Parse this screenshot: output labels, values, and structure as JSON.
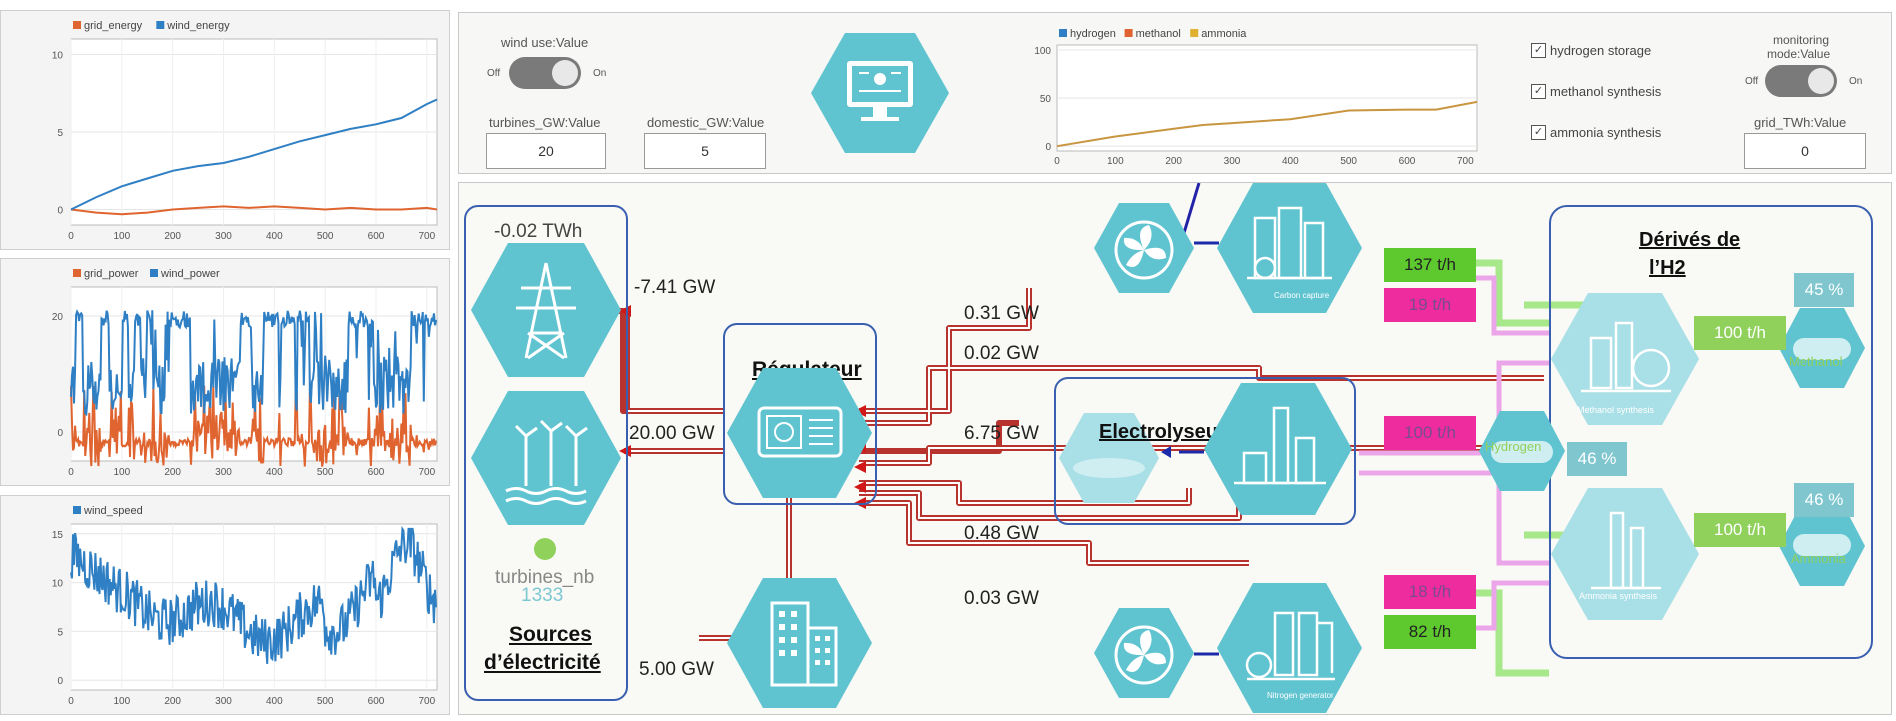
{
  "left_charts": [
    {
      "legend": [
        {
          "name": "grid_energy",
          "color": "#e0642f"
        },
        {
          "name": "wind_energy",
          "color": "#2f7fc4"
        }
      ],
      "ylim": [
        -1,
        11
      ],
      "yticks": [
        "10",
        "5",
        "0"
      ],
      "xticks": [
        "0",
        "100",
        "200",
        "300",
        "400",
        "500",
        "600",
        "700"
      ]
    },
    {
      "legend": [
        {
          "name": "grid_power",
          "color": "#e0642f"
        },
        {
          "name": "wind_power",
          "color": "#2f7fc4"
        }
      ],
      "ylim": [
        -5,
        25
      ],
      "yticks": [
        "20",
        "0"
      ],
      "xticks": [
        "0",
        "100",
        "200",
        "300",
        "400",
        "500",
        "600",
        "700"
      ]
    },
    {
      "legend": [
        {
          "name": "wind_speed",
          "color": "#2f7fc4"
        }
      ],
      "ylim": [
        -1,
        16
      ],
      "yticks": [
        "15",
        "10",
        "5",
        "0"
      ],
      "xticks": [
        "0",
        "100",
        "200",
        "300",
        "400",
        "500",
        "600",
        "700"
      ]
    }
  ],
  "controls": {
    "wind_use_label": "wind use:Value",
    "off": "Off",
    "on": "On",
    "turbines_label": "turbines_GW:Value",
    "turbines_value": "20",
    "domestic_label": "domestic_GW:Value",
    "domestic_value": "5",
    "monitoring_label_1": "monitoring",
    "monitoring_label_2": "mode:Value",
    "grid_twh_label": "grid_TWh:Value",
    "grid_twh_value": "0",
    "checks": [
      "hydrogen storage",
      "methanol synthesis",
      "ammonia synthesis"
    ]
  },
  "chart_data": [
    {
      "type": "line",
      "x": [
        0,
        50,
        100,
        150,
        200,
        250,
        300,
        350,
        400,
        450,
        500,
        550,
        600,
        650,
        700,
        720
      ],
      "series": [
        {
          "name": "wind_energy",
          "color": "#2f7fc4",
          "values": [
            0,
            0.8,
            1.5,
            2.0,
            2.5,
            2.8,
            3.0,
            3.4,
            3.9,
            4.4,
            4.8,
            5.2,
            5.5,
            5.9,
            6.8,
            7.1
          ]
        },
        {
          "name": "grid_energy",
          "color": "#e0642f",
          "values": [
            0,
            -0.2,
            -0.3,
            -0.2,
            0,
            0.1,
            0.2,
            0.1,
            0.2,
            0.1,
            0,
            0.1,
            0,
            0,
            0.1,
            0
          ]
        }
      ],
      "xlim": [
        0,
        720
      ],
      "ylim": [
        -1,
        11
      ]
    },
    {
      "type": "line",
      "x": [
        0,
        720
      ],
      "series": [
        {
          "name": "grid_power",
          "color": "#e0642f",
          "values": []
        },
        {
          "name": "wind_power",
          "color": "#2f7fc4",
          "values": []
        }
      ],
      "xlim": [
        0,
        720
      ],
      "ylim": [
        -5,
        25
      ]
    },
    {
      "type": "line",
      "x": [
        0,
        720
      ],
      "series": [
        {
          "name": "wind_speed",
          "color": "#2f7fc4",
          "values": []
        }
      ],
      "xlim": [
        0,
        720
      ],
      "ylim": [
        -1,
        16
      ]
    },
    {
      "type": "line",
      "legend": [
        {
          "name": "hydrogen",
          "color": "#2f7fc4"
        },
        {
          "name": "methanol",
          "color": "#e0642f"
        },
        {
          "name": "ammonia",
          "color": "#e0b030"
        }
      ],
      "x": [
        0,
        100,
        200,
        250,
        300,
        400,
        500,
        600,
        650,
        720
      ],
      "series": [
        {
          "name": "ammonia",
          "color": "#c89540",
          "values": [
            0,
            10,
            18,
            22,
            24,
            28,
            37,
            38,
            38,
            46
          ]
        }
      ],
      "yticks": [
        "100",
        "50",
        "0"
      ],
      "xticks": [
        "0",
        "100",
        "200",
        "300",
        "400",
        "500",
        "600",
        "700"
      ],
      "xlim": [
        0,
        720
      ],
      "ylim": [
        -5,
        105
      ]
    }
  ],
  "diagram": {
    "grid_twh": "-0.02 TWh",
    "grid_gw": "-7.41 GW",
    "wind_gw": "20.00 GW",
    "domestic_gw": "5.00 GW",
    "turbines_nb_label": "turbines_nb",
    "turbines_nb_value": "1333",
    "sources_title_1": "Sources",
    "sources_title_2": "d’électricité",
    "regulator_title": "Régulateur",
    "electrolyzers_title": "Electrolyseurs",
    "derivatives_title_1": "Dérivés de",
    "derivatives_title_2": "l’H2",
    "line_031": "0.31 GW",
    "line_002": "0.02 GW",
    "line_675": "6.75 GW",
    "line_048": "0.48 GW",
    "line_003": "0.03 GW",
    "carbon_capture": "Carbon capture",
    "nitrogen_generator": "Nitrogen generator",
    "methanol_synthesis": "Methanol synthesis",
    "ammonia_synthesis": "Ammonia synthesis",
    "methanol": "Methanol",
    "ammonia": "Ammonia",
    "hydrogen": "Hydrogen",
    "co2_rate": "137 t/h",
    "h2_methanol_rate": "19 t/h",
    "h2_rate": "100 t/h",
    "h2_ammonia_rate": "18 t/h",
    "n2_rate": "82 t/h",
    "methanol_rate": "100 t/h",
    "ammonia_rate": "100 t/h",
    "methanol_pct": "45 %",
    "hydrogen_pct": "46 %",
    "ammonia_pct": "46 %"
  },
  "colors": {
    "teal": "#5fc4d0",
    "teal_light": "#a9dfe6",
    "power_line": "#b8322e",
    "green": "#8fd15a",
    "magenta": "#ee2c9d",
    "frame": "#3a5fb0"
  }
}
